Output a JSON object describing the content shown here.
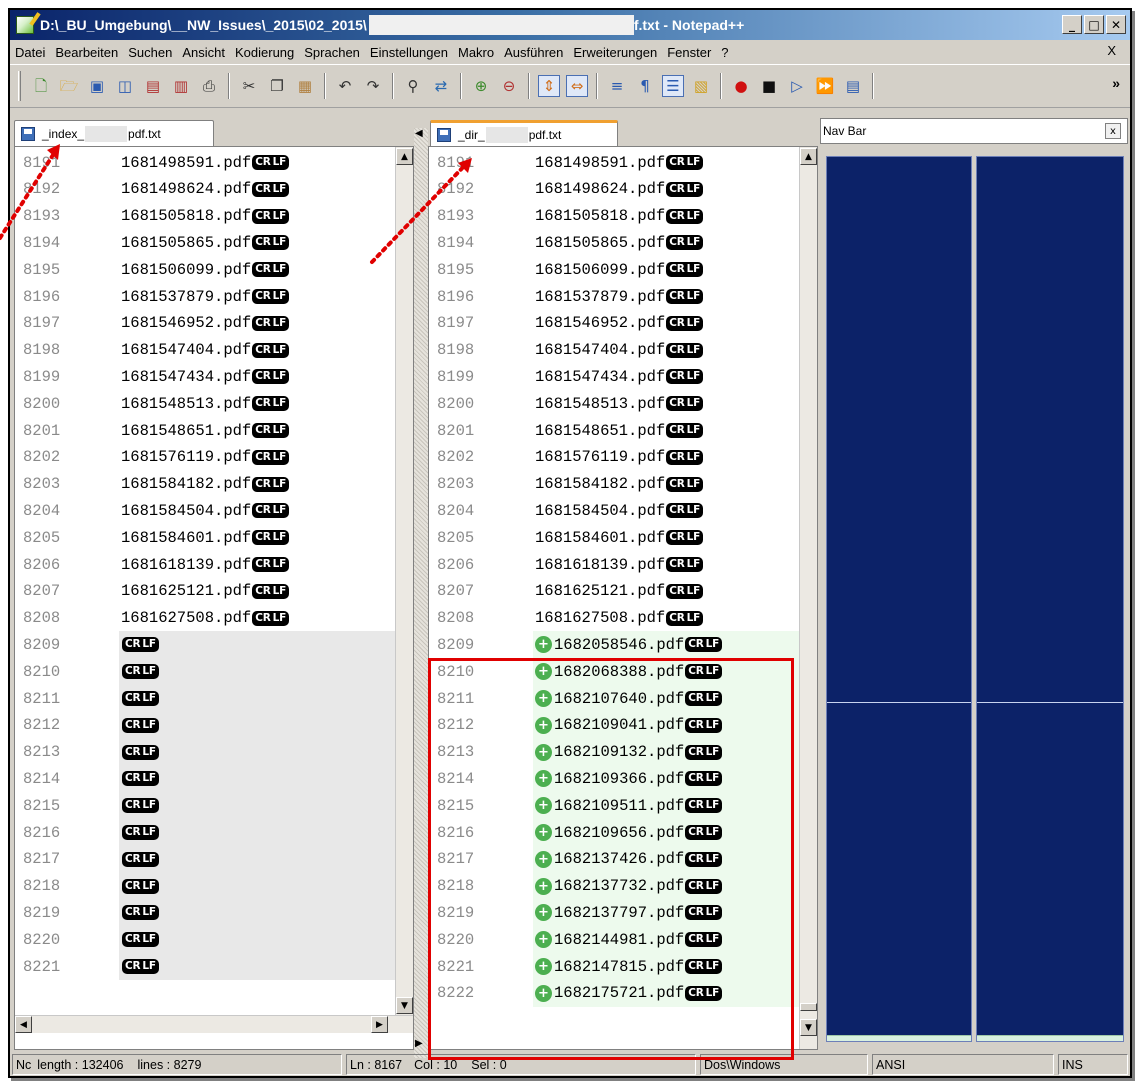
{
  "window": {
    "title_prefix": "D:\\_BU_Umgebung\\__NW_Issues\\_2015\\02_2015\\",
    "title_suffix": "f.txt - Notepad++",
    "caption_buttons": [
      "_",
      "□",
      "✕"
    ]
  },
  "menu": {
    "items": [
      "Datei",
      "Bearbeiten",
      "Suchen",
      "Ansicht",
      "Kodierung",
      "Sprachen",
      "Einstellungen",
      "Makro",
      "Ausführen",
      "Erweiterungen",
      "Fenster",
      "?"
    ],
    "close": "X"
  },
  "toolbar": {
    "icons": [
      "new-file-icon",
      "open-file-icon",
      "save-icon",
      "save-all-icon",
      "close-icon",
      "close-all-icon",
      "print-icon",
      "cut-icon",
      "copy-icon",
      "paste-icon",
      "undo-icon",
      "redo-icon",
      "find-icon",
      "replace-icon",
      "zoom-in-icon",
      "zoom-out-icon",
      "sync-vertical-icon",
      "sync-horizontal-icon",
      "word-wrap-icon",
      "show-all-chars-icon",
      "indent-guide-icon",
      "doc-map-icon",
      "record-macro-icon",
      "stop-record-icon",
      "play-macro-icon",
      "run-macro-multiple-icon",
      "save-macro-icon"
    ],
    "more": "»"
  },
  "left_tab": {
    "prefix": "_index_",
    "suffix": "pdf.txt"
  },
  "right_tab": {
    "prefix": "_dir_",
    "suffix": "pdf.txt"
  },
  "left_pane": {
    "lines": [
      {
        "num": "8191",
        "text": "1681498591.pdf"
      },
      {
        "num": "8192",
        "text": "1681498624.pdf"
      },
      {
        "num": "8193",
        "text": "1681505818.pdf"
      },
      {
        "num": "8194",
        "text": "1681505865.pdf"
      },
      {
        "num": "8195",
        "text": "1681506099.pdf"
      },
      {
        "num": "8196",
        "text": "1681537879.pdf"
      },
      {
        "num": "8197",
        "text": "1681546952.pdf"
      },
      {
        "num": "8198",
        "text": "1681547404.pdf"
      },
      {
        "num": "8199",
        "text": "1681547434.pdf"
      },
      {
        "num": "8200",
        "text": "1681548513.pdf"
      },
      {
        "num": "8201",
        "text": "1681548651.pdf"
      },
      {
        "num": "8202",
        "text": "1681576119.pdf"
      },
      {
        "num": "8203",
        "text": "1681584182.pdf"
      },
      {
        "num": "8204",
        "text": "1681584504.pdf"
      },
      {
        "num": "8205",
        "text": "1681584601.pdf"
      },
      {
        "num": "8206",
        "text": "1681618139.pdf"
      },
      {
        "num": "8207",
        "text": "1681625121.pdf"
      },
      {
        "num": "8208",
        "text": "1681627508.pdf"
      },
      {
        "num": "8209",
        "text": ""
      },
      {
        "num": "8210",
        "text": ""
      },
      {
        "num": "8211",
        "text": ""
      },
      {
        "num": "8212",
        "text": ""
      },
      {
        "num": "8213",
        "text": ""
      },
      {
        "num": "8214",
        "text": ""
      },
      {
        "num": "8215",
        "text": ""
      },
      {
        "num": "8216",
        "text": ""
      },
      {
        "num": "8217",
        "text": ""
      },
      {
        "num": "8218",
        "text": ""
      },
      {
        "num": "8219",
        "text": ""
      },
      {
        "num": "8220",
        "text": ""
      },
      {
        "num": "8221",
        "text": ""
      }
    ]
  },
  "right_pane": {
    "lines": [
      {
        "num": "8191",
        "text": "1681498591.pdf",
        "added": false
      },
      {
        "num": "8192",
        "text": "1681498624.pdf",
        "added": false
      },
      {
        "num": "8193",
        "text": "1681505818.pdf",
        "added": false
      },
      {
        "num": "8194",
        "text": "1681505865.pdf",
        "added": false
      },
      {
        "num": "8195",
        "text": "1681506099.pdf",
        "added": false
      },
      {
        "num": "8196",
        "text": "1681537879.pdf",
        "added": false
      },
      {
        "num": "8197",
        "text": "1681546952.pdf",
        "added": false
      },
      {
        "num": "8198",
        "text": "1681547404.pdf",
        "added": false
      },
      {
        "num": "8199",
        "text": "1681547434.pdf",
        "added": false
      },
      {
        "num": "8200",
        "text": "1681548513.pdf",
        "added": false
      },
      {
        "num": "8201",
        "text": "1681548651.pdf",
        "added": false
      },
      {
        "num": "8202",
        "text": "1681576119.pdf",
        "added": false
      },
      {
        "num": "8203",
        "text": "1681584182.pdf",
        "added": false
      },
      {
        "num": "8204",
        "text": "1681584504.pdf",
        "added": false
      },
      {
        "num": "8205",
        "text": "1681584601.pdf",
        "added": false
      },
      {
        "num": "8206",
        "text": "1681618139.pdf",
        "added": false
      },
      {
        "num": "8207",
        "text": "1681625121.pdf",
        "added": false
      },
      {
        "num": "8208",
        "text": "1681627508.pdf",
        "added": false
      },
      {
        "num": "8209",
        "text": "1682058546.pdf",
        "added": true
      },
      {
        "num": "8210",
        "text": "1682068388.pdf",
        "added": true
      },
      {
        "num": "8211",
        "text": "1682107640.pdf",
        "added": true
      },
      {
        "num": "8212",
        "text": "1682109041.pdf",
        "added": true
      },
      {
        "num": "8213",
        "text": "1682109132.pdf",
        "added": true
      },
      {
        "num": "8214",
        "text": "1682109366.pdf",
        "added": true
      },
      {
        "num": "8215",
        "text": "1682109511.pdf",
        "added": true
      },
      {
        "num": "8216",
        "text": "1682109656.pdf",
        "added": true
      },
      {
        "num": "8217",
        "text": "1682137426.pdf",
        "added": true
      },
      {
        "num": "8218",
        "text": "1682137732.pdf",
        "added": true
      },
      {
        "num": "8219",
        "text": "1682137797.pdf",
        "added": true
      },
      {
        "num": "8220",
        "text": "1682144981.pdf",
        "added": true
      },
      {
        "num": "8221",
        "text": "1682147815.pdf",
        "added": true
      },
      {
        "num": "8222",
        "text": "1682175721.pdf",
        "added": true
      }
    ]
  },
  "eol_marker": {
    "cr": "CR",
    "lf": "LF"
  },
  "add_marker": "+",
  "nav_bar": {
    "title": "Nav Bar",
    "close": "x"
  },
  "status": {
    "doc_type": "Nc",
    "length": "length : 132406",
    "lines": "lines : 8279",
    "ln": "Ln : 8167",
    "col": "Col : 10",
    "sel": "Sel : 0",
    "eol": "Dos\\Windows",
    "encoding": "ANSI",
    "mode": "INS"
  },
  "colors": {
    "added_line_bg": "#edfaed",
    "blank_line_bg": "#e8e8e8",
    "nav_bg": "#0c2268",
    "annotation_red": "#e00000"
  }
}
